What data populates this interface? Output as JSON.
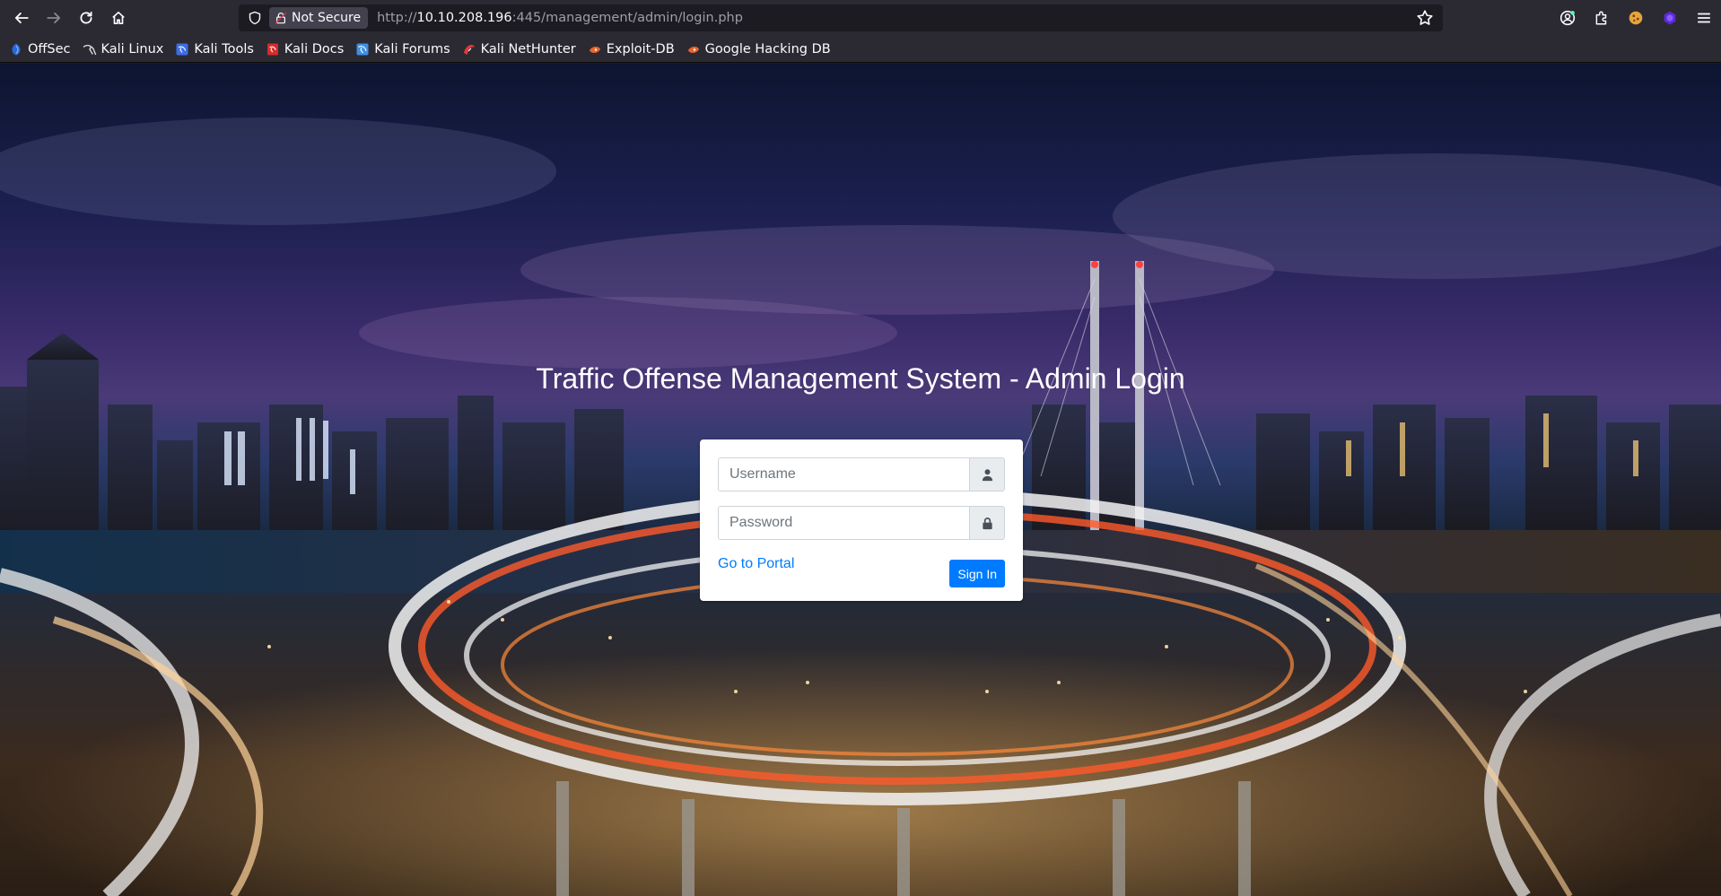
{
  "browser": {
    "url_security_label": "Not Secure",
    "url_prefix": "http://",
    "url_host": "10.10.208.196",
    "url_path": ":445/management/admin/login.php"
  },
  "bookmarks": [
    {
      "label": "OffSec",
      "icon": "offsec-icon",
      "color": "#2a6ad8"
    },
    {
      "label": "Kali Linux",
      "icon": "kali-dragon-icon",
      "color": "#c9c9c9"
    },
    {
      "label": "Kali Tools",
      "icon": "kali-tools-icon",
      "color": "#3d6de6"
    },
    {
      "label": "Kali Docs",
      "icon": "kali-docs-icon",
      "color": "#d62b2b"
    },
    {
      "label": "Kali Forums",
      "icon": "kali-forums-icon",
      "color": "#3d8fe6"
    },
    {
      "label": "Kali NetHunter",
      "icon": "nethunter-icon",
      "color": "#e03a3a"
    },
    {
      "label": "Exploit-DB",
      "icon": "exploit-db-icon",
      "color": "#e8642a"
    },
    {
      "label": "Google Hacking DB",
      "icon": "ghdb-icon",
      "color": "#e8642a"
    }
  ],
  "page": {
    "title": "Traffic Offense Management System - Admin Login",
    "username_placeholder": "Username",
    "password_placeholder": "Password",
    "portal_link": "Go to Portal",
    "signin_label": "Sign In",
    "accent_color": "#007bff"
  }
}
